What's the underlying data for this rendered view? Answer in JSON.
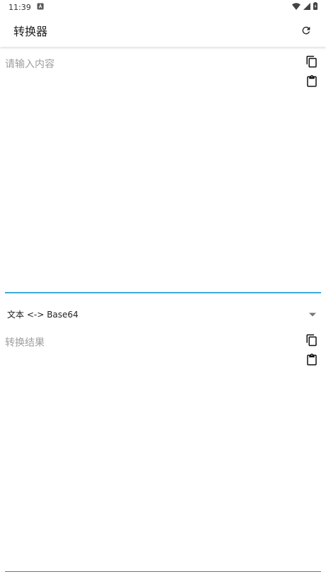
{
  "status_bar": {
    "time": "11:39"
  },
  "app_bar": {
    "title": "转换器"
  },
  "input": {
    "placeholder": "请输入内容"
  },
  "converter": {
    "selected_option": "文本 <-> Base64"
  },
  "output": {
    "placeholder": "转换结果"
  },
  "colors": {
    "accent": "#3fa9d8",
    "placeholder": "#9e9e9e",
    "divider": "#757575"
  }
}
